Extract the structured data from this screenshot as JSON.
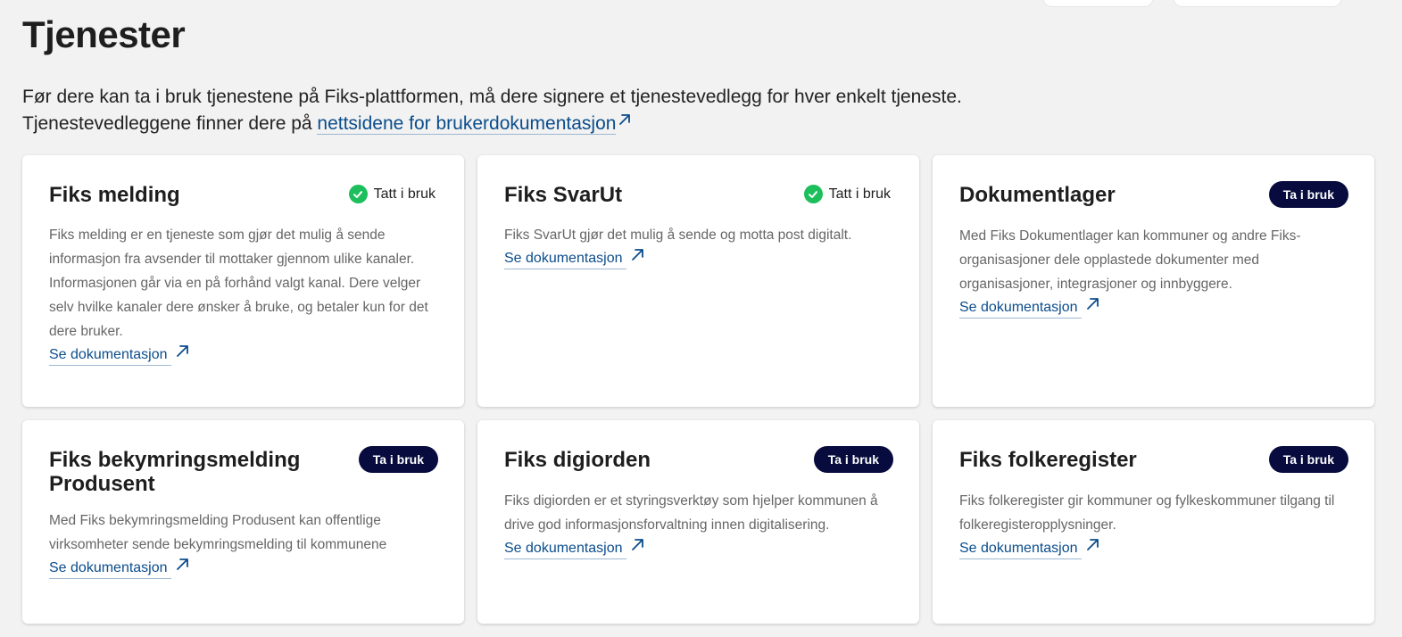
{
  "page": {
    "title": "Tjenester",
    "intro_line1": "Før dere kan ta i bruk tjenestene på Fiks-plattformen, må dere signere et tjenestevedlegg for hver enkelt tjeneste.",
    "intro_line2_prefix": "Tjenestevedleggene finner dere på ",
    "intro_link": "nettsidene for brukerdokumentasjon"
  },
  "colors": {
    "link": "#0b4d8c",
    "badge_bg": "#070b3d",
    "check_green": "#1dbf5c"
  },
  "cards": [
    {
      "title": "Fiks melding",
      "status": "Tatt i bruk",
      "description": "Fiks melding er en tjeneste som gjør det mulig å sende informasjon fra avsender til mottaker gjennom ulike kanaler. Informasjonen går via en på forhånd valgt kanal. Dere velger selv hvilke kanaler dere ønsker å bruke, og betaler kun for det dere bruker.",
      "link": "Se dokumentasjon"
    },
    {
      "title": "Fiks SvarUt",
      "status": "Tatt i bruk",
      "description": "Fiks SvarUt gjør det mulig å sende og motta post digitalt.",
      "link": "Se dokumentasjon"
    },
    {
      "title": "Dokumentlager",
      "badge": "Ta i bruk",
      "description": "Med Fiks Dokumentlager kan kommuner og andre Fiks-organisasjoner dele opplastede dokumenter med organisasjoner, integrasjoner og innbyggere.",
      "link": "Se dokumentasjon"
    },
    {
      "title": "Fiks bekymringsmelding Produsent",
      "badge": "Ta i bruk",
      "description": "Med Fiks bekymringsmelding Produsent kan offentlige virksomheter sende bekymringsmelding til kommunene",
      "link": "Se dokumentasjon"
    },
    {
      "title": "Fiks digiorden",
      "badge": "Ta i bruk",
      "description": "Fiks digiorden er et styringsverktøy som hjelper kommunen å drive god informasjonsforvaltning innen digitalisering.",
      "link": "Se dokumentasjon"
    },
    {
      "title": "Fiks folkeregister",
      "badge": "Ta i bruk",
      "description": "Fiks folkeregister gir kommuner og fylkeskommuner tilgang til folkeregisteropplysninger.",
      "link": "Se dokumentasjon"
    }
  ]
}
